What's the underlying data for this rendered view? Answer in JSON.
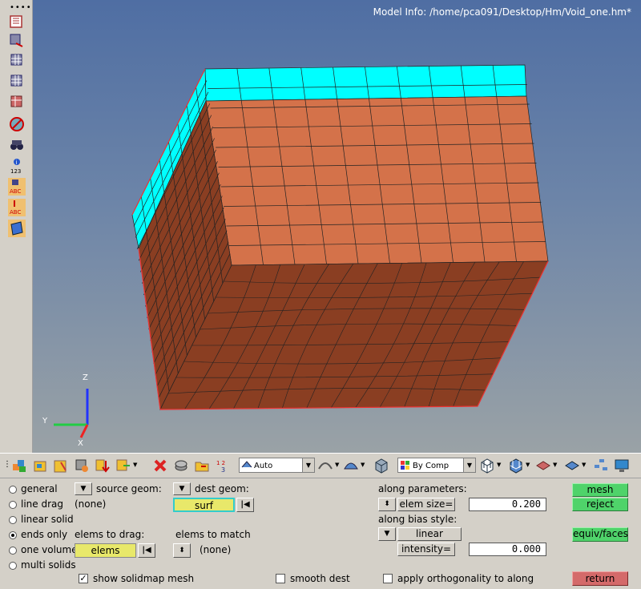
{
  "model_info": "Model Info: /home/pca091/Desktop/Hm/Void_one.hm*",
  "triad": {
    "z": "Z",
    "y": "Y",
    "x": "X"
  },
  "toolbar": {
    "auto_select": "Auto",
    "by_comp_select": "By Comp"
  },
  "panel": {
    "radios": [
      {
        "label": "general",
        "selected": false
      },
      {
        "label": "line drag",
        "selected": false
      },
      {
        "label": "linear solid",
        "selected": false
      },
      {
        "label": "ends only",
        "selected": true
      },
      {
        "label": "one volume",
        "selected": false
      },
      {
        "label": "multi solids",
        "selected": false
      }
    ],
    "source_geom_label": "source geom:",
    "source_geom_value": "(none)",
    "dest_geom_label": "dest geom:",
    "dest_geom_button": "surf",
    "elems_to_drag_label": "elems to drag:",
    "elems_button": "elems",
    "elems_to_match_label": "elems to match",
    "elems_to_match_value": "(none)",
    "along_parameters_label": "along parameters:",
    "elem_size_label": "elem size=",
    "elem_size_value": "0.200",
    "along_bias_style_label": "along bias style:",
    "bias_style_value": "linear",
    "intensity_label": "intensity=",
    "intensity_value": "0.000",
    "show_solidmap_mesh": "show solidmap mesh",
    "show_solidmap_checked": true,
    "smooth_dest": "smooth dest",
    "apply_orthogonality": "apply orthogonality to along",
    "mesh_button": "mesh",
    "reject_button": "reject",
    "equiv_faces_button": "equiv/faces",
    "return_button": "return"
  },
  "colors": {
    "cyan": "#00ffff",
    "orange": "#d4724a",
    "dark_brown": "#8a3e22",
    "green_button": "#4fd36a",
    "red_button": "#d46a6a",
    "yellow_button": "#e8e86a"
  }
}
